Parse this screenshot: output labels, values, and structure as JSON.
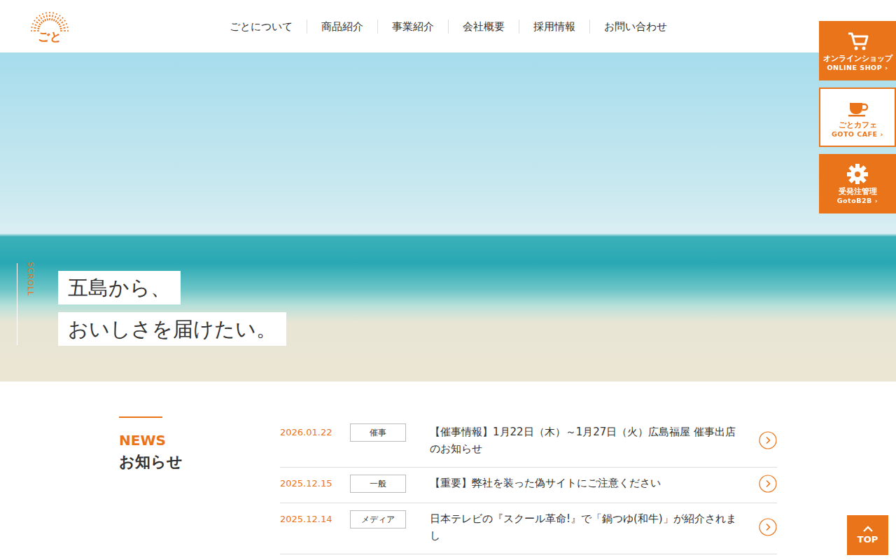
{
  "logo": {
    "text": "ごと"
  },
  "nav": [
    {
      "label": "ごとについて"
    },
    {
      "label": "商品紹介"
    },
    {
      "label": "事業紹介"
    },
    {
      "label": "会社概要"
    },
    {
      "label": "採用情報"
    },
    {
      "label": "お問い合わせ"
    }
  ],
  "side_links": [
    {
      "label": "オンラインショップ",
      "sub": "ONLINE SHOP",
      "arrow": "›",
      "kind": "filled",
      "icon": "cart"
    },
    {
      "label": "ごとカフェ",
      "sub": "GOTO CAFE",
      "arrow": "›",
      "kind": "outline",
      "icon": "cup"
    },
    {
      "label": "受発注管理",
      "sub": "GotoB2B",
      "arrow": "›",
      "kind": "filled",
      "icon": "gear"
    }
  ],
  "hero": {
    "lines": [
      "五島から、",
      "おいしさを届けたい。"
    ],
    "scroll": "SCROLL"
  },
  "news": {
    "heading_en": "NEWS",
    "heading": "お知らせ",
    "items": [
      {
        "date": "2026.01.22",
        "category": "催事",
        "title": "【催事情報】1月22日（木）～1月27日（火）広島福屋 催事出店のお知らせ"
      },
      {
        "date": "2025.12.15",
        "category": "一般",
        "title": "【重要】弊社を装った偽サイトにご注意ください"
      },
      {
        "date": "2025.12.14",
        "category": "メディア",
        "title": "日本テレビの『スクール革命!』で「鍋つゆ(和牛)」が紹介されまし"
      }
    ]
  },
  "top_button": {
    "label": "TOP"
  }
}
